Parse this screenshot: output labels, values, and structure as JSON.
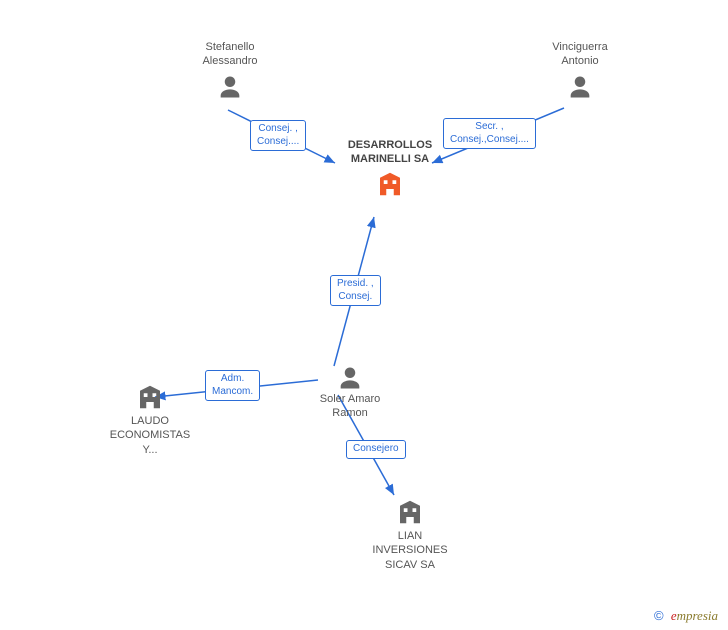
{
  "nodes": {
    "person1": {
      "name_line1": "Stefanello",
      "name_line2": "Alessandro"
    },
    "person2": {
      "name_line1": "Vinciguerra",
      "name_line2": "Antonio"
    },
    "person3": {
      "name_line1": "Soler Amaro",
      "name_line2": "Ramon"
    },
    "company_central": {
      "name_line1": "DESARROLLOS",
      "name_line2": "MARINELLI SA"
    },
    "company_laudo": {
      "name_line1": "LAUDO",
      "name_line2": "ECONOMISTAS",
      "name_line3": "Y..."
    },
    "company_lian": {
      "name_line1": "LIAN",
      "name_line2": "INVERSIONES",
      "name_line3": "SICAV SA"
    }
  },
  "edges": {
    "e1": {
      "label_line1": "Consej. ,",
      "label_line2": "Consej...."
    },
    "e2": {
      "label_line1": "Secr. ,",
      "label_line2": "Consej.,Consej...."
    },
    "e3": {
      "label_line1": "Presid. ,",
      "label_line2": "Consej."
    },
    "e4": {
      "label_line1": "Adm.",
      "label_line2": "Mancom."
    },
    "e5": {
      "label": "Consejero"
    }
  },
  "watermark": {
    "copyright": "©",
    "brand_first": "e",
    "brand_rest": "mpresia"
  }
}
